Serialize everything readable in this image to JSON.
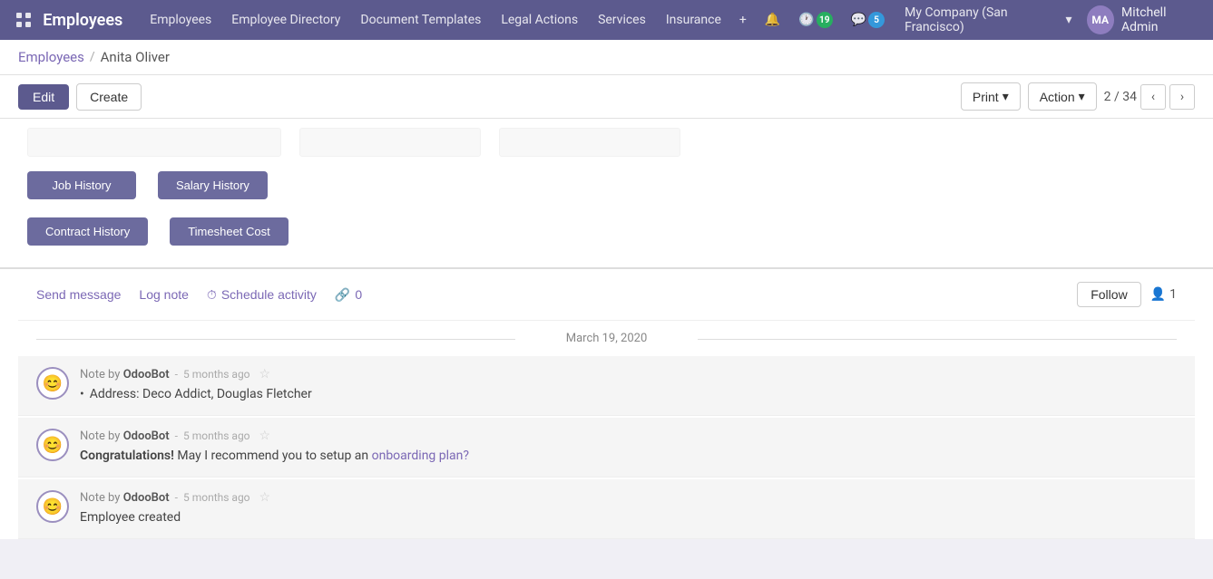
{
  "app": {
    "title": "Employees"
  },
  "topnav": {
    "title": "Employees",
    "links": [
      "Employees",
      "Employee Directory",
      "Document Templates",
      "Legal Actions",
      "Services",
      "Insurance"
    ],
    "badge_green": "19",
    "badge_blue": "5",
    "company": "My Company (San Francisco)",
    "user": "Mitchell Admin"
  },
  "breadcrumb": {
    "parent": "Employees",
    "separator": "/",
    "current": "Anita Oliver"
  },
  "toolbar": {
    "edit_label": "Edit",
    "create_label": "Create",
    "print_label": "Print",
    "action_label": "Action",
    "pagination": "2 / 34"
  },
  "smart_buttons": {
    "row1": [
      "Job History",
      "Salary History"
    ],
    "row2": [
      "Contract History",
      "Timesheet Cost"
    ]
  },
  "chatter": {
    "send_message": "Send message",
    "log_note": "Log note",
    "schedule_activity": "Schedule activity",
    "links_count": "0",
    "follow_label": "Follow",
    "follower_count": "1"
  },
  "date_separator": "March 19, 2020",
  "messages": [
    {
      "author": "OdooBot",
      "time": "5 months ago",
      "prefix": "Note by",
      "content_type": "bullet",
      "bullet": "Address: Deco Addict, Douglas Fletcher"
    },
    {
      "author": "OdooBot",
      "time": "5 months ago",
      "prefix": "Note by",
      "content_type": "congrats",
      "bold_part": "Congratulations!",
      "text": " May I recommend you to setup an ",
      "link_text": "onboarding plan?",
      "link_href": "#"
    },
    {
      "author": "OdooBot",
      "time": "5 months ago",
      "prefix": "Note by",
      "content_type": "plain",
      "text": "Employee created"
    }
  ]
}
